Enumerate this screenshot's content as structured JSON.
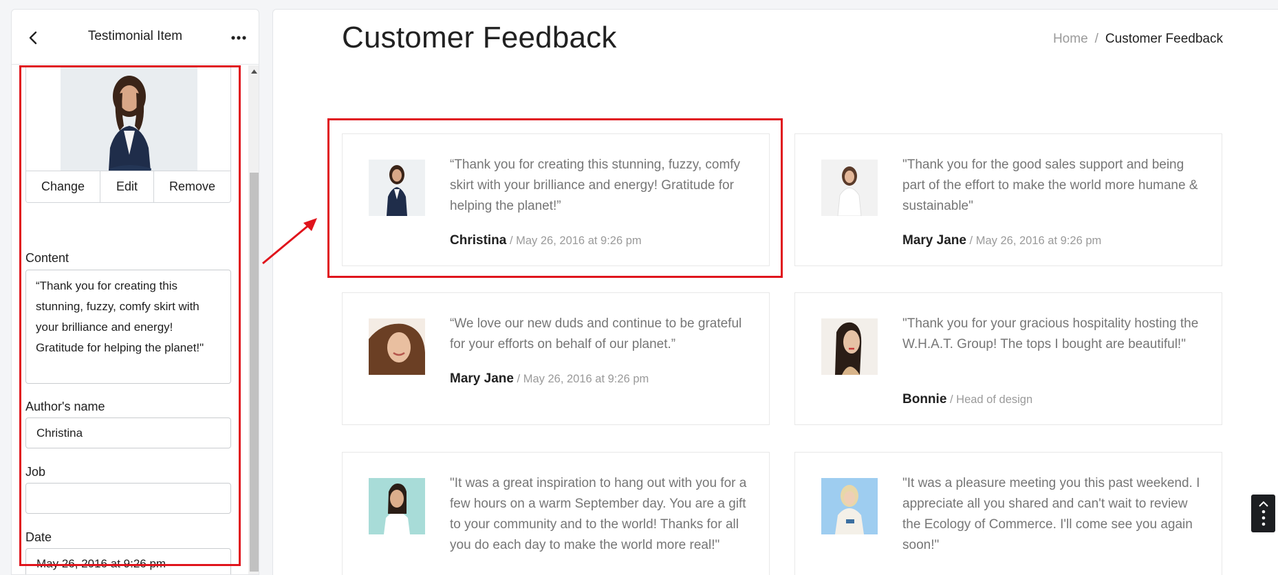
{
  "editor": {
    "title": "Testimonial Item",
    "image_actions": {
      "change": "Change",
      "edit": "Edit",
      "remove": "Remove"
    },
    "fields": {
      "content_label": "Content",
      "content_value": "“Thank you for creating this stunning, fuzzy, comfy skirt with your brilliance and energy! Gratitude for helping the planet!\"",
      "author_label": "Author's name",
      "author_value": "Christina",
      "job_label": "Job",
      "job_value": "",
      "date_label": "Date",
      "date_value": "May 26, 2016 at 9:26 pm"
    }
  },
  "page": {
    "title": "Customer Feedback",
    "breadcrumb": {
      "home": "Home",
      "separator": "/",
      "current": "Customer Feedback"
    }
  },
  "testimonials": [
    {
      "quote": "“Thank you for creating this stunning, fuzzy, comfy skirt with your brilliance and energy! Gratitude for helping the planet!”",
      "author": "Christina",
      "meta": "/ May 26, 2016 at 9:26 pm"
    },
    {
      "quote": "\"Thank you for the good sales support and being part of the effort to make the world more humane & sustainable\"",
      "author": "Mary Jane",
      "meta": "/ May 26, 2016 at 9:26 pm"
    },
    {
      "quote": "“We love our new duds and continue to be grateful for your efforts on behalf of our planet.”",
      "author": "Mary Jane",
      "meta": "/ May 26, 2016 at 9:26 pm"
    },
    {
      "quote": "\"Thank you for your gracious hospitality hosting the W.H.A.T. Group! The tops I bought are beautiful!\"",
      "author": "Bonnie",
      "meta": "/ Head of design"
    },
    {
      "quote": "\"It was a great inspiration to hang out with you for a few hours on a warm September day. You are a gift to your community and to the world! Thanks for all you do each day to make the world more real!\"",
      "author": "",
      "meta": ""
    },
    {
      "quote": "\"It was a pleasure meeting you this past weekend. I appreciate all you shared and can't wait to review the Ecology of Commerce. I'll come see you again soon!\"",
      "author": "",
      "meta": ""
    }
  ],
  "colors": {
    "highlight": "#e0141c",
    "heading": "#212121",
    "muted": "#767676"
  }
}
